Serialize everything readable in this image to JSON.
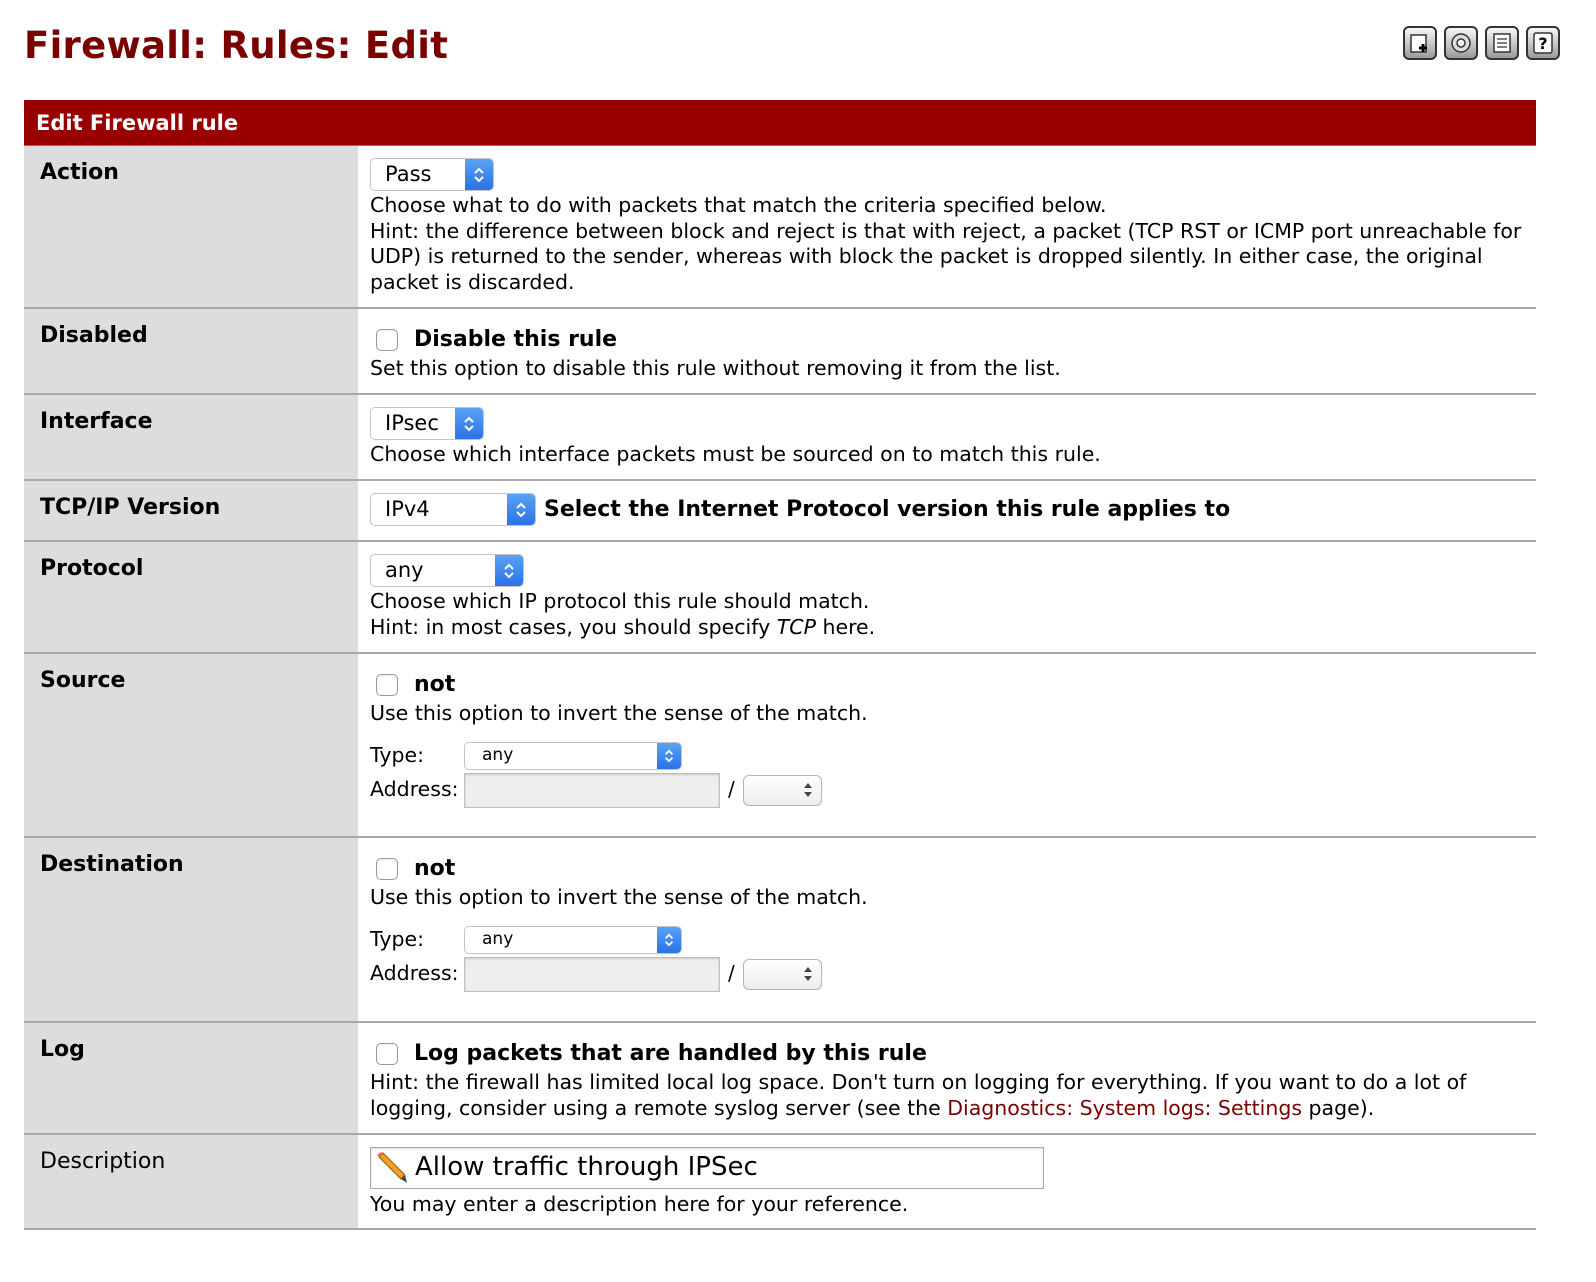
{
  "page": {
    "title": "Firewall: Rules: Edit"
  },
  "toolbar": {
    "icons": [
      "add-icon",
      "settings-icon",
      "log-icon",
      "help-icon"
    ]
  },
  "panel": {
    "header": "Edit Firewall rule"
  },
  "action": {
    "label": "Action",
    "selected": "Pass",
    "desc1": "Choose what to do with packets that match the criteria specified below.",
    "desc2": "Hint: the difference between block and reject is that with reject, a packet (TCP RST or ICMP port unreachable for UDP) is returned to the sender, whereas with block the packet is dropped silently. In either case, the original packet is discarded."
  },
  "disabled": {
    "label": "Disabled",
    "checkbox_label": "Disable this rule",
    "desc": "Set this option to disable this rule without removing it from the list."
  },
  "interface": {
    "label": "Interface",
    "selected": "IPsec",
    "desc": "Choose which interface packets must be sourced on to match this rule."
  },
  "tcpip": {
    "label": "TCP/IP Version",
    "selected": "IPv4",
    "hint": "Select the Internet Protocol version this rule applies to"
  },
  "protocol": {
    "label": "Protocol",
    "selected": "any",
    "desc1": "Choose which IP protocol this rule should match.",
    "desc2_pre": "Hint: in most cases, you should specify ",
    "desc2_em": "TCP",
    "desc2_post": " here."
  },
  "source": {
    "label": "Source",
    "not_label": "not",
    "desc": "Use this option to invert the sense of the match.",
    "type_label": "Type:",
    "type_selected": "any",
    "address_label": "Address:",
    "slash": "/"
  },
  "destination": {
    "label": "Destination",
    "not_label": "not",
    "desc": "Use this option to invert the sense of the match.",
    "type_label": "Type:",
    "type_selected": "any",
    "address_label": "Address:",
    "slash": "/"
  },
  "log": {
    "label": "Log",
    "checkbox_label": "Log packets that are handled by this rule",
    "desc_pre": "Hint: the firewall has limited local log space. Don't turn on logging for everything. If you want to do a lot of logging, consider using a remote syslog server (see the ",
    "link": "Diagnostics: System logs: Settings",
    "desc_post": " page)."
  },
  "description": {
    "label": "Description",
    "value": "Allow traffic through IPSec",
    "desc": "You may enter a description here for your reference."
  },
  "colors": {
    "title": "#7a0000",
    "header_bg": "#990000",
    "label_bg": "#dddddd",
    "select_arrow": "#2a72e6",
    "link": "#7a0000"
  }
}
